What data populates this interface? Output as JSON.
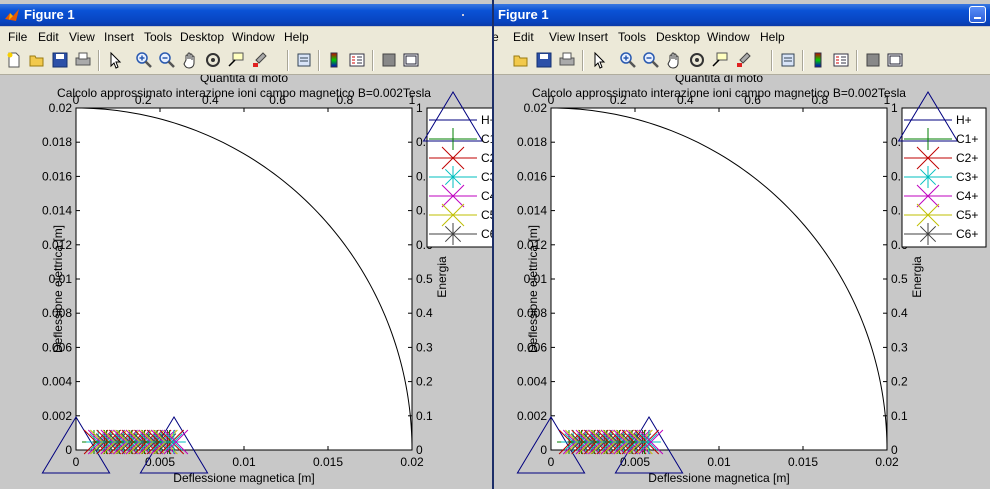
{
  "windows": [
    {
      "id": "left",
      "title": "Figure 1",
      "menu": [
        "File",
        "Edit",
        "View",
        "Insert",
        "Tools",
        "Desktop",
        "Window",
        "Help"
      ]
    },
    {
      "id": "right",
      "title": "Figure 1",
      "menu": [
        "e",
        "Edit",
        "View",
        "Insert",
        "Tools",
        "Desktop",
        "Window",
        "Help"
      ]
    }
  ],
  "toolbar_icons": [
    "new-figure-icon",
    "open-file-icon",
    "save-icon",
    "print-icon",
    "pointer-icon",
    "zoom-in-icon",
    "zoom-out-icon",
    "pan-icon",
    "rotate-3d-icon",
    "data-cursor-icon",
    "brush-icon",
    "link-plot-icon",
    "colorbar-icon",
    "legend-icon",
    "hide-plot-tools-icon",
    "show-plot-tools-icon"
  ],
  "chart_data": {
    "type": "line",
    "title": "Calcolo approssimato interazione ioni campo magnetico B=0.002Tesla",
    "xlabel": "Deflessione magnetica [m]",
    "ylabel": "Deflessione elettrica [m]",
    "top_xlabel": "Quantità di moto",
    "right_ylabel": "Energia",
    "xlim": [
      0,
      0.02
    ],
    "ylim": [
      0,
      0.02
    ],
    "x_ticks": [
      "0",
      "0.005",
      "0.01",
      "0.015",
      "0.02"
    ],
    "y_ticks": [
      "0",
      "0.002",
      "0.004",
      "0.006",
      "0.008",
      "0.01",
      "0.012",
      "0.014",
      "0.016",
      "0.018",
      "0.02"
    ],
    "top_x_ticks": [
      "0",
      "0.2",
      "0.4",
      "0.6",
      "0.8",
      "1"
    ],
    "right_y_ticks": [
      "0",
      "0.1",
      "0.2",
      "0.3",
      "0.4",
      "0.5",
      "0.6",
      "0.7",
      "0.8",
      "0.9",
      "1"
    ],
    "grid": false,
    "legend_position": "top-right, outside axes",
    "series": [
      {
        "name": "H+",
        "color": "#00007f",
        "marker": "triangle"
      },
      {
        "name": "C1+",
        "color": "#007f00",
        "marker": "plus"
      },
      {
        "name": "C2+",
        "color": "#bf0000",
        "marker": "x"
      },
      {
        "name": "C3+",
        "color": "#00bfbf",
        "marker": "star"
      },
      {
        "name": "C4+",
        "color": "#bf00bf",
        "marker": "x"
      },
      {
        "name": "C5+",
        "color": "#bfbf00",
        "marker": "x"
      },
      {
        "name": "C6+",
        "color": "#404040",
        "marker": "star"
      }
    ],
    "arc": {
      "radius": 0.02,
      "color": "#000000"
    }
  }
}
